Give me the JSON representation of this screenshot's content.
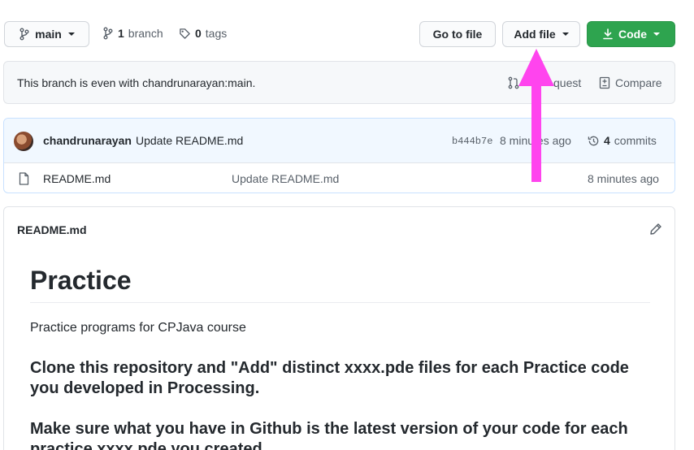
{
  "branch": {
    "name": "main",
    "count": "1",
    "count_label": "branch"
  },
  "tags": {
    "count": "0",
    "label": "tags"
  },
  "buttons": {
    "goto": "Go to file",
    "add_file": "Add file",
    "code": "Code"
  },
  "compare_bar": {
    "status": "This branch is even with chandrunarayan:main.",
    "pull_request": "quest",
    "compare": "Compare"
  },
  "commit": {
    "author": "chandrunarayan",
    "message": "Update README.md",
    "sha": "b444b7e",
    "time": "8 minutes ago",
    "count": "4",
    "count_label": "commits"
  },
  "files": [
    {
      "name": "README.md",
      "message": "Update README.md",
      "time": "8 minutes ago"
    }
  ],
  "readme": {
    "filename": "README.md",
    "heading": "Practice",
    "description": "Practice programs for CPJava course",
    "instruction1": "Clone this repository and \"Add\" distinct xxxx.pde files for each Practice code you developed in Processing.",
    "instruction2": "Make sure what you have in Github is the latest version of your code for each practice xxxx.pde you created."
  },
  "annotation": {
    "arrow_color": "#ff44ee"
  },
  "colors": {
    "code_button": "#2ea44f",
    "link": "#0366d6"
  }
}
